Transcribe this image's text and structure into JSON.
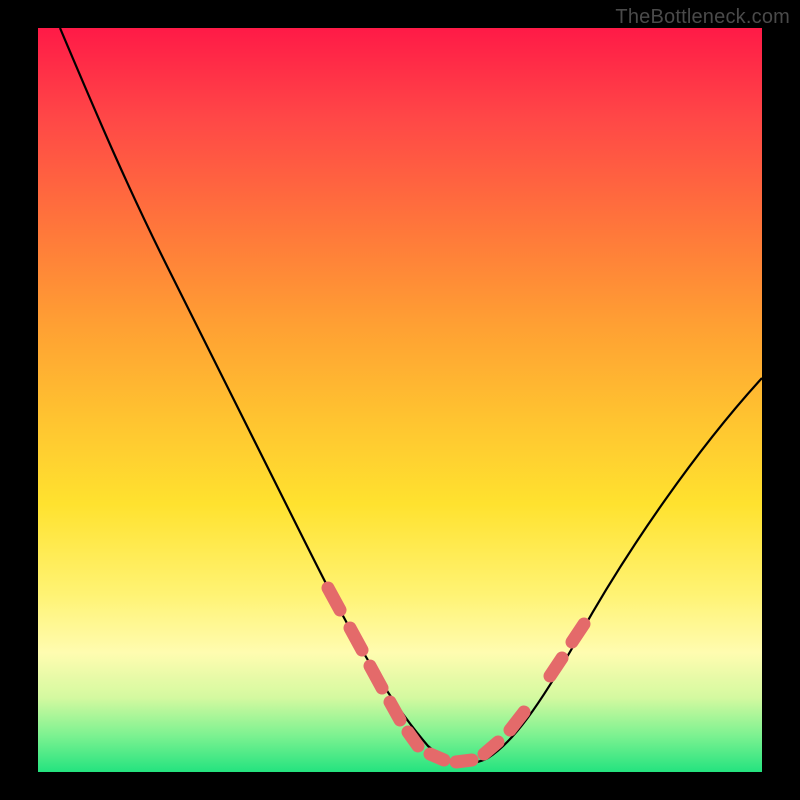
{
  "watermark": "TheBottleneck.com",
  "chart_data": {
    "type": "line",
    "title": "",
    "xlabel": "",
    "ylabel": "",
    "xlim": [
      0,
      100
    ],
    "ylim": [
      0,
      100
    ],
    "grid": false,
    "legend": false,
    "annotations": [],
    "series": [
      {
        "name": "bottleneck-curve",
        "color": "#000000",
        "x": [
          3,
          8,
          12,
          18,
          24,
          30,
          36,
          42,
          47,
          50,
          53,
          56,
          59,
          62,
          66,
          72,
          80,
          90,
          100
        ],
        "y": [
          100,
          88,
          78,
          66,
          54,
          42,
          31,
          20,
          11,
          6,
          3,
          2,
          2,
          4,
          8,
          16,
          28,
          42,
          54
        ]
      },
      {
        "name": "highlight-left",
        "color": "#e46a6a",
        "style": "dashed-thick",
        "x": [
          36,
          42,
          47,
          50,
          53
        ],
        "y": [
          31,
          20,
          11,
          6,
          3
        ]
      },
      {
        "name": "highlight-bottom",
        "color": "#e46a6a",
        "style": "dashed-thick",
        "x": [
          53,
          56,
          59,
          62
        ],
        "y": [
          3,
          2,
          2,
          4
        ]
      },
      {
        "name": "highlight-right",
        "color": "#e46a6a",
        "style": "dashed-thick",
        "x": [
          62,
          66,
          72
        ],
        "y": [
          4,
          8,
          16
        ]
      }
    ]
  }
}
